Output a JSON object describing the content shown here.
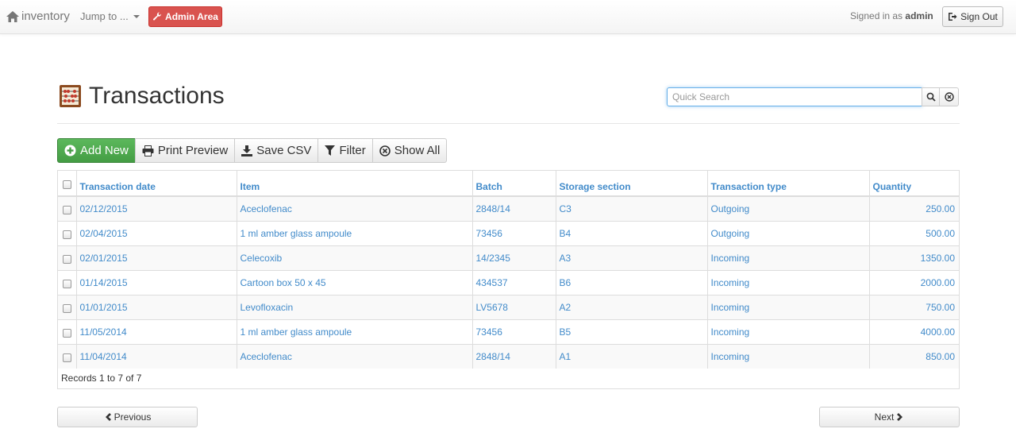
{
  "navbar": {
    "brand": "inventory",
    "jump_to": "Jump to ...",
    "admin_area": "Admin Area",
    "signed_in_prefix": "Signed in as",
    "username": "admin",
    "sign_out": "Sign Out"
  },
  "header": {
    "title": "Transactions",
    "search_placeholder": "Quick Search"
  },
  "toolbar": {
    "add_new": "Add New",
    "print_preview": "Print Preview",
    "save_csv": "Save CSV",
    "filter": "Filter",
    "show_all": "Show All"
  },
  "table": {
    "columns": [
      "Transaction date",
      "Item",
      "Batch",
      "Storage section",
      "Transaction type",
      "Quantity"
    ],
    "rows": [
      [
        "02/12/2015",
        "Aceclofenac",
        "2848/14",
        "C3",
        "Outgoing",
        "250.00"
      ],
      [
        "02/04/2015",
        "1 ml amber glass ampoule",
        "73456",
        "B4",
        "Outgoing",
        "500.00"
      ],
      [
        "02/01/2015",
        "Celecoxib",
        "14/2345",
        "A3",
        "Incoming",
        "1350.00"
      ],
      [
        "01/14/2015",
        "Cartoon box 50 x 45",
        "434537",
        "B6",
        "Incoming",
        "2000.00"
      ],
      [
        "01/01/2015",
        "Levofloxacin",
        "LV5678",
        "A2",
        "Incoming",
        "750.00"
      ],
      [
        "11/05/2014",
        "1 ml amber glass ampoule",
        "73456",
        "B5",
        "Incoming",
        "4000.00"
      ],
      [
        "11/04/2014",
        "Aceclofenac",
        "2848/14",
        "A1",
        "Incoming",
        "850.00"
      ]
    ],
    "records_text": "Records 1 to 7 of 7"
  },
  "pager": {
    "previous": "Previous",
    "next": "Next"
  },
  "colors": {
    "link": "#428bca",
    "admin": "#d9534f",
    "add_new": "#5cb85c"
  }
}
